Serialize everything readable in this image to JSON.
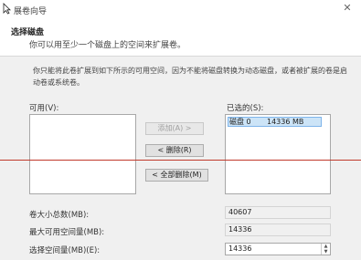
{
  "window": {
    "title": "展卷向导",
    "close_glyph": "✕"
  },
  "header": {
    "title": "选择磁盘",
    "subtitle": "你可以用至少一个磁盘上的空间来扩展卷。"
  },
  "description": "你只能将此卷扩展到如下所示的可用空间，因为不能将磁盘转换为动态磁盘，或者被扩展的卷是启动卷或系统卷。",
  "available": {
    "label": "可用(V):",
    "items": []
  },
  "selected": {
    "label": "已选的(S):",
    "items": [
      {
        "disk": "磁盘 0",
        "size": "14336 MB"
      }
    ]
  },
  "buttons": {
    "add": "添加(A) >",
    "remove": "< 删除(R)",
    "remove_all": "< 全部删除(M)"
  },
  "fields": {
    "total_label": "卷大小总数(MB):",
    "total_value": "40607",
    "max_label": "最大可用空间量(MB):",
    "max_value": "14336",
    "select_label": "选择空间量(MB)(E):",
    "select_value": "14336"
  },
  "colors": {
    "selection_bg": "#cce4f7",
    "annotation_line": "#c0392b"
  }
}
